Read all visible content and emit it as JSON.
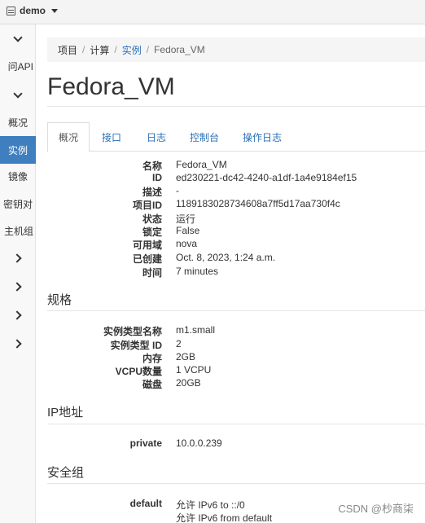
{
  "header": {
    "project": "demo"
  },
  "sidebar": {
    "items": [
      {
        "label": ""
      },
      {
        "label": "问API"
      },
      {
        "label": ""
      },
      {
        "label": "概况"
      },
      {
        "label": "实例"
      },
      {
        "label": "镜像"
      },
      {
        "label": "密钥对"
      },
      {
        "label": "主机组"
      }
    ]
  },
  "breadcrumb": {
    "items": [
      "项目",
      "计算",
      "实例",
      "Fedora_VM"
    ]
  },
  "page": {
    "title": "Fedora_VM"
  },
  "tabs": [
    {
      "label": "概况"
    },
    {
      "label": "接口"
    },
    {
      "label": "日志"
    },
    {
      "label": "控制台"
    },
    {
      "label": "操作日志"
    }
  ],
  "overview": [
    {
      "k": "名称",
      "v": "Fedora_VM"
    },
    {
      "k": "ID",
      "v": "ed230221-dc42-4240-a1df-1a4e9184ef15"
    },
    {
      "k": "描述",
      "v": "-"
    },
    {
      "k": "项目ID",
      "v": "1189183028734608a7ff5d17aa730f4c"
    },
    {
      "k": "状态",
      "v": "运行"
    },
    {
      "k": "锁定",
      "v": "False"
    },
    {
      "k": "可用域",
      "v": "nova"
    },
    {
      "k": "已创建",
      "v": "Oct. 8, 2023, 1:24 a.m."
    },
    {
      "k": "时间",
      "v": "7 minutes"
    }
  ],
  "specs": {
    "title": "规格",
    "rows": [
      {
        "k": "实例类型名称",
        "v": "m1.small"
      },
      {
        "k": "实例类型 ID",
        "v": "2"
      },
      {
        "k": "内存",
        "v": "2GB"
      },
      {
        "k": "VCPU数量",
        "v": "1 VCPU"
      },
      {
        "k": "磁盘",
        "v": "20GB"
      }
    ]
  },
  "ip": {
    "title": "IP地址",
    "rows": [
      {
        "k": "private",
        "v": "10.0.0.239"
      }
    ]
  },
  "security": {
    "title": "安全组",
    "group": "default",
    "rules": [
      "允许 IPv6 to ::/0",
      "允许 IPv6 from default"
    ]
  },
  "watermark": "CSDN @杪商柒"
}
